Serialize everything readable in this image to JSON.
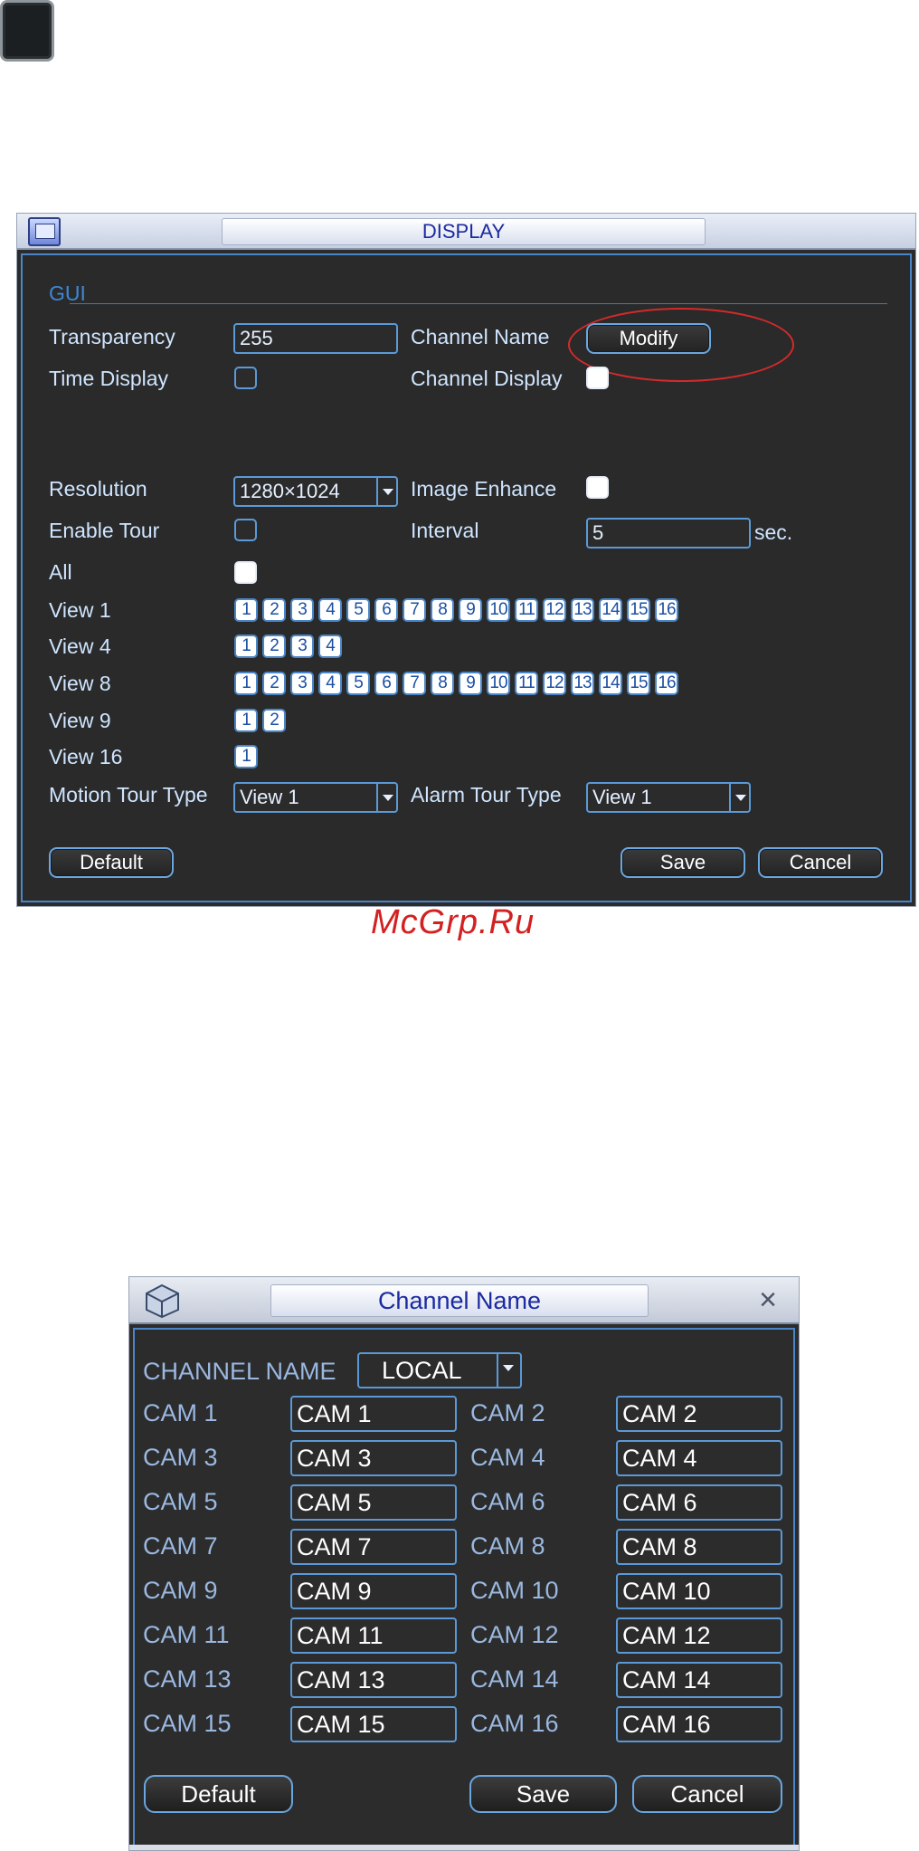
{
  "display_window": {
    "title": "DISPLAY",
    "section_gui": "GUI",
    "transparency": {
      "label": "Transparency",
      "value": "255"
    },
    "channel_name": {
      "label": "Channel Name",
      "button": "Modify"
    },
    "time_display": {
      "label": "Time Display",
      "checked": false
    },
    "channel_display": {
      "label": "Channel Display",
      "checked": true
    },
    "resolution": {
      "label": "Resolution",
      "value": "1280×1024"
    },
    "image_enhance": {
      "label": "Image Enhance",
      "checked": true
    },
    "enable_tour": {
      "label": "Enable Tour",
      "checked": false
    },
    "interval": {
      "label": "Interval",
      "value": "5",
      "unit": "sec."
    },
    "all": {
      "label": "All",
      "checked": true
    },
    "view1": {
      "label": "View 1",
      "channels": [
        "1",
        "2",
        "3",
        "4",
        "5",
        "6",
        "7",
        "8",
        "9",
        "10",
        "11",
        "12",
        "13",
        "14",
        "15",
        "16"
      ]
    },
    "view4": {
      "label": "View 4",
      "channels": [
        "1",
        "2",
        "3",
        "4"
      ]
    },
    "view8": {
      "label": "View 8",
      "channels": [
        "1",
        "2",
        "3",
        "4",
        "5",
        "6",
        "7",
        "8",
        "9",
        "10",
        "11",
        "12",
        "13",
        "14",
        "15",
        "16"
      ]
    },
    "view9": {
      "label": "View 9",
      "channels": [
        "1",
        "2"
      ]
    },
    "view16": {
      "label": "View 16",
      "channels": [
        "1"
      ]
    },
    "motion_tour_type": {
      "label": "Motion Tour Type",
      "value": "View 1"
    },
    "alarm_tour_type": {
      "label": "Alarm Tour Type",
      "value": "View 1"
    },
    "buttons": {
      "default": "Default",
      "save": "Save",
      "cancel": "Cancel"
    }
  },
  "watermark": "McGrp.Ru",
  "channel_name_window": {
    "title": "Channel Name",
    "selector": {
      "label": "CHANNEL NAME",
      "value": "LOCAL"
    },
    "rows": [
      {
        "left_label": "CAM 1",
        "left_value": "CAM 1",
        "right_label": "CAM 2",
        "right_value": "CAM 2"
      },
      {
        "left_label": "CAM 3",
        "left_value": "CAM 3",
        "right_label": "CAM 4",
        "right_value": "CAM 4"
      },
      {
        "left_label": "CAM 5",
        "left_value": "CAM 5",
        "right_label": "CAM 6",
        "right_value": "CAM 6"
      },
      {
        "left_label": "CAM 7",
        "left_value": "CAM 7",
        "right_label": "CAM 8",
        "right_value": "CAM 8"
      },
      {
        "left_label": "CAM 9",
        "left_value": "CAM 9",
        "right_label": "CAM 10",
        "right_value": "CAM 10"
      },
      {
        "left_label": "CAM 11",
        "left_value": "CAM 11",
        "right_label": "CAM 12",
        "right_value": "CAM 12"
      },
      {
        "left_label": "CAM 13",
        "left_value": "CAM 13",
        "right_label": "CAM 14",
        "right_value": "CAM 14"
      },
      {
        "left_label": "CAM 15",
        "left_value": "CAM 15",
        "right_label": "CAM 16",
        "right_value": "CAM 16"
      }
    ],
    "buttons": {
      "default": "Default",
      "save": "Save",
      "cancel": "Cancel"
    }
  },
  "colors": {
    "panel_bg": "#2b2b2b",
    "accent_blue": "#4a86c7",
    "label_text": "#cfe5ff",
    "title_text": "#1b2aa0",
    "highlight_red": "#d62a2a"
  }
}
